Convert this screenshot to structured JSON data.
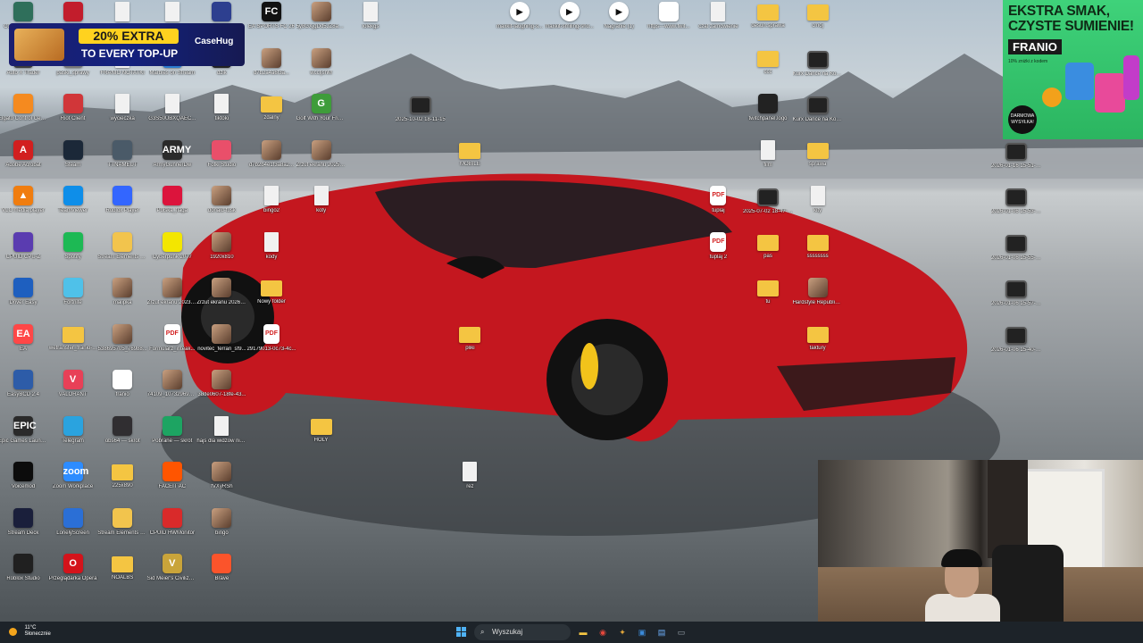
{
  "desktop": {
    "icons": [
      {
        "label": "Counter-Strike 2",
        "glyph": "",
        "kind": "app",
        "color": "#2f6f5b",
        "col": 0,
        "row": 0
      },
      {
        "label": "Auto X Trader",
        "glyph": "",
        "kind": "app",
        "color": "#3b3b3b",
        "col": 0,
        "row": 1
      },
      {
        "label": "Elgato Control Center",
        "glyph": "",
        "kind": "app",
        "color": "#f58a1f",
        "col": 0,
        "row": 2
      },
      {
        "label": "Adobe Acrobat",
        "glyph": "A",
        "kind": "app",
        "color": "#d21f1f",
        "col": 0,
        "row": 3
      },
      {
        "label": "VLC media player",
        "glyph": "▲",
        "kind": "app",
        "color": "#f07d0f",
        "col": 0,
        "row": 4
      },
      {
        "label": "CPUID CPU-Z",
        "glyph": "",
        "kind": "app",
        "color": "#5a3cb0",
        "col": 0,
        "row": 5
      },
      {
        "label": "Driver Easy",
        "glyph": "",
        "kind": "app",
        "color": "#1e5fbf",
        "col": 0,
        "row": 6
      },
      {
        "label": "EA",
        "glyph": "EA",
        "kind": "app",
        "color": "#ff4747",
        "col": 0,
        "row": 7
      },
      {
        "label": "EasyBCD 2.4",
        "glyph": "",
        "kind": "app",
        "color": "#2d5ca8",
        "col": 0,
        "row": 8
      },
      {
        "label": "Epic Games Launcher",
        "glyph": "EPIC",
        "kind": "app",
        "color": "#2a2a2a",
        "col": 0,
        "row": 9
      },
      {
        "label": "Voicemod",
        "glyph": "",
        "kind": "app",
        "color": "#0c0c0c",
        "col": 0,
        "row": 10
      },
      {
        "label": "Stream Deck",
        "glyph": "",
        "kind": "app",
        "color": "#1a1f3b",
        "col": 0,
        "row": 11
      },
      {
        "label": "Roblox Studio",
        "glyph": "",
        "kind": "app",
        "color": "#202020",
        "col": 0,
        "row": 12
      },
      {
        "label": "",
        "glyph": "",
        "kind": "app",
        "color": "#c21d2c",
        "col": 1,
        "row": 0
      },
      {
        "label": "paski_sprawy",
        "glyph": "",
        "kind": "app",
        "color": "#777",
        "col": 1,
        "row": 1
      },
      {
        "label": "Riot Client",
        "glyph": "",
        "kind": "app",
        "color": "#d13639",
        "col": 1,
        "row": 2
      },
      {
        "label": "Steam",
        "glyph": "",
        "kind": "app",
        "color": "#1b2838",
        "col": 1,
        "row": 3
      },
      {
        "label": "TeamViewer",
        "glyph": "",
        "kind": "app",
        "color": "#0e8ee9",
        "col": 1,
        "row": 4
      },
      {
        "label": "Spotify",
        "glyph": "",
        "kind": "app",
        "color": "#1db954",
        "col": 1,
        "row": 5
      },
      {
        "label": "Fortnite",
        "glyph": "",
        "kind": "app",
        "color": "#4fc1e9",
        "col": 1,
        "row": 6
      },
      {
        "label": "wetransfer_franio-...",
        "glyph": "",
        "kind": "folder",
        "color": "#f4c542",
        "col": 1,
        "row": 7
      },
      {
        "label": "VALORANT",
        "glyph": "V",
        "kind": "app",
        "color": "#e84057",
        "col": 1,
        "row": 8
      },
      {
        "label": "Telegram",
        "glyph": "",
        "kind": "app",
        "color": "#2aa3df",
        "col": 1,
        "row": 9
      },
      {
        "label": "Zoom Workplace",
        "glyph": "zoom",
        "kind": "app",
        "color": "#2d8cff",
        "col": 1,
        "row": 10
      },
      {
        "label": "LonelyScreen",
        "glyph": "",
        "kind": "app",
        "color": "#2b6fd6",
        "col": 1,
        "row": 11
      },
      {
        "label": "Przeglądarka Opera",
        "glyph": "O",
        "kind": "app",
        "color": "#d4131b",
        "col": 1,
        "row": 12
      },
      {
        "label": "",
        "glyph": "",
        "kind": "file",
        "color": "#f1f1f1",
        "col": 2,
        "row": 0
      },
      {
        "label": "FRANIO NOTATKI",
        "glyph": "",
        "kind": "file",
        "color": "#f1f1f1",
        "col": 2,
        "row": 1
      },
      {
        "label": "wycieczka",
        "glyph": "",
        "kind": "file",
        "color": "#f1f1f1",
        "col": 2,
        "row": 2
      },
      {
        "label": "TTNAMEUT",
        "glyph": "",
        "kind": "app",
        "color": "#4a5a68",
        "col": 2,
        "row": 3
      },
      {
        "label": "Roblox Player",
        "glyph": "",
        "kind": "app",
        "color": "#3366ff",
        "col": 2,
        "row": 4
      },
      {
        "label": "Stream Elements SE.Live",
        "glyph": "",
        "kind": "app",
        "color": "#f2c44d",
        "col": 2,
        "row": 5
      },
      {
        "label": "malipka",
        "glyph": "",
        "kind": "photo",
        "color": "#8a6b52",
        "col": 2,
        "row": 6
      },
      {
        "label": "538695705_76988...",
        "glyph": "",
        "kind": "photo",
        "color": "#8a6b52",
        "col": 2,
        "row": 7
      },
      {
        "label": "franio",
        "glyph": "",
        "kind": "app",
        "color": "#ffffff",
        "col": 2,
        "row": 8
      },
      {
        "label": "obs64 — skrót",
        "glyph": "",
        "kind": "app",
        "color": "#302e31",
        "col": 2,
        "row": 9
      },
      {
        "label": "225x890",
        "glyph": "",
        "kind": "folder",
        "color": "#f4c542",
        "col": 2,
        "row": 10
      },
      {
        "label": "Stream Elements SE.Live",
        "glyph": "",
        "kind": "app",
        "color": "#f2c44d",
        "col": 2,
        "row": 11
      },
      {
        "label": "NOALBS",
        "glyph": "",
        "kind": "folder",
        "color": "#f4c542",
        "col": 2,
        "row": 12
      },
      {
        "label": "",
        "glyph": "",
        "kind": "file",
        "color": "#f1f1f1",
        "col": 3,
        "row": 0
      },
      {
        "label": "Marbles on Stream",
        "glyph": "",
        "kind": "app",
        "color": "#2a7bd0",
        "col": 3,
        "row": 1
      },
      {
        "label": "G3S50UBXQAEC...",
        "glyph": "",
        "kind": "file",
        "color": "#f1f1f1",
        "col": 3,
        "row": 2
      },
      {
        "label": "ArmyGunnerDw",
        "glyph": "ARMY",
        "kind": "app",
        "color": "#2a2a2a",
        "col": 3,
        "row": 3
      },
      {
        "label": "Polska_flaga",
        "glyph": "",
        "kind": "app",
        "color": "#dc143c",
        "col": 3,
        "row": 4
      },
      {
        "label": "Cyberpunk 2077",
        "glyph": "",
        "kind": "app",
        "color": "#f3e600",
        "col": 3,
        "row": 5
      },
      {
        "label": "Zrzut ekranu 2023-12-18 205224",
        "glyph": "",
        "kind": "photo",
        "color": "#8a6b52",
        "col": 3,
        "row": 6
      },
      {
        "label": "Formularz_inteak...",
        "glyph": "PDF",
        "kind": "pdf",
        "color": "#ffffff",
        "col": 3,
        "row": 7
      },
      {
        "label": "74109_1073296993...",
        "glyph": "",
        "kind": "photo",
        "color": "#8a6b52",
        "col": 3,
        "row": 8
      },
      {
        "label": "Pobrane — skrót",
        "glyph": "",
        "kind": "app",
        "color": "#1da462",
        "col": 3,
        "row": 9
      },
      {
        "label": "FACEIT AC",
        "glyph": "",
        "kind": "app",
        "color": "#ff5500",
        "col": 3,
        "row": 10
      },
      {
        "label": "CPUID HWMonitor",
        "glyph": "",
        "kind": "app",
        "color": "#d92a2a",
        "col": 3,
        "row": 11
      },
      {
        "label": "Sid Meier's Civilization V",
        "glyph": "V",
        "kind": "app",
        "color": "#c9a43a",
        "col": 3,
        "row": 12
      },
      {
        "label": "",
        "glyph": "",
        "kind": "app",
        "color": "#2d3f8f",
        "col": 4,
        "row": 0
      },
      {
        "label": "dzik",
        "glyph": "",
        "kind": "app",
        "color": "#222",
        "col": 4,
        "row": 1
      },
      {
        "label": "tiktoki",
        "glyph": "",
        "kind": "file",
        "color": "#f1f1f1",
        "col": 4,
        "row": 2
      },
      {
        "label": "Fotki Studio",
        "glyph": "",
        "kind": "app",
        "color": "#e94f6a",
        "col": 4,
        "row": 3
      },
      {
        "label": "donald-tusk",
        "glyph": "",
        "kind": "photo",
        "color": "#8a6b52",
        "col": 4,
        "row": 4
      },
      {
        "label": "1920x810",
        "glyph": "",
        "kind": "photo",
        "color": "#8a6b52",
        "col": 4,
        "row": 5
      },
      {
        "label": "Zrzut ekranu 2026-01-17 132350",
        "glyph": "",
        "kind": "photo",
        "color": "#8a6b52",
        "col": 4,
        "row": 6
      },
      {
        "label": "novitec_ferrari_sf9...",
        "glyph": "",
        "kind": "photo",
        "color": "#b62027",
        "col": 4,
        "row": 7
      },
      {
        "label": "38de0607-18fe-43...",
        "glyph": "",
        "kind": "photo",
        "color": "#8a6b52",
        "col": 4,
        "row": 8
      },
      {
        "label": "hajs dla widzow nie otwierac",
        "glyph": "",
        "kind": "file",
        "color": "#f1f1f1",
        "col": 4,
        "row": 9
      },
      {
        "label": "fVXyRSh",
        "glyph": "",
        "kind": "photo",
        "color": "#4b8a55",
        "col": 4,
        "row": 10
      },
      {
        "label": "bingo",
        "glyph": "",
        "kind": "photo",
        "color": "#c7774d",
        "col": 4,
        "row": 11
      },
      {
        "label": "Brave",
        "glyph": "",
        "kind": "app",
        "color": "#fb542b",
        "col": 4,
        "row": 12
      },
      {
        "label": "EA SPORTS FC 26",
        "glyph": "FC",
        "kind": "app",
        "color": "#111",
        "col": 5,
        "row": 0
      },
      {
        "label": "d7b2a4a6f3a...",
        "glyph": "",
        "kind": "photo",
        "color": "#8a6b52",
        "col": 5,
        "row": 1
      },
      {
        "label": "zdalny",
        "glyph": "",
        "kind": "folder",
        "color": "#f4c542",
        "col": 5,
        "row": 2
      },
      {
        "label": "d7b2b4e1f3a8a2...",
        "glyph": "",
        "kind": "photo",
        "color": "#8a6b52",
        "col": 5,
        "row": 3
      },
      {
        "label": "bingo2",
        "glyph": "",
        "kind": "file",
        "color": "#f1f1f1",
        "col": 5,
        "row": 4
      },
      {
        "label": "kody",
        "glyph": "",
        "kind": "file",
        "color": "#f1f1f1",
        "col": 5,
        "row": 5
      },
      {
        "label": "Nowy folder",
        "glyph": "",
        "kind": "folder",
        "color": "#f4c542",
        "col": 5,
        "row": 6
      },
      {
        "label": "29179013-0c73-4c...",
        "glyph": "PDF",
        "kind": "pdf",
        "color": "#ffffff",
        "col": 5,
        "row": 7
      },
      {
        "label": "5y8GXjgDd5JZ8aS...",
        "glyph": "",
        "kind": "photo",
        "color": "#8a6b52",
        "col": 6,
        "row": 0
      },
      {
        "label": "wccfjsnM",
        "glyph": "",
        "kind": "photo",
        "color": "#8a6b52",
        "col": 6,
        "row": 1
      },
      {
        "label": "Golf With Your Friends",
        "glyph": "G",
        "kind": "app",
        "color": "#3e9c3a",
        "col": 6,
        "row": 2
      },
      {
        "label": "Zrzut ekranu 2025-01-19 021722",
        "glyph": "",
        "kind": "photo",
        "color": "#8a6b52",
        "col": 6,
        "row": 3
      },
      {
        "label": "koty",
        "glyph": "",
        "kind": "file",
        "color": "#f1f1f1",
        "col": 6,
        "row": 4
      },
      {
        "label": "HOLY",
        "glyph": "",
        "kind": "folder",
        "color": "#f4c542",
        "col": 6,
        "row": 9
      },
      {
        "label": "lolekgs",
        "glyph": "",
        "kind": "file",
        "color": "#f1f1f1",
        "col": 7,
        "row": 0
      },
      {
        "label": "2025-10-02 18-11-15",
        "glyph": "",
        "kind": "video",
        "color": "#222",
        "col": 8,
        "row": 2
      },
      {
        "label": "MOBILE",
        "glyph": "",
        "kind": "folder",
        "color": "#f4c542",
        "col": 9,
        "row": 3
      },
      {
        "label": "pliki",
        "glyph": "",
        "kind": "folder",
        "color": "#f4c542",
        "col": 9,
        "row": 7
      },
      {
        "label": "rez",
        "glyph": "",
        "kind": "file",
        "color": "#f1f1f1",
        "col": 9,
        "row": 10
      },
      {
        "label": "maxkit-laughing-s...",
        "glyph": "▶",
        "kind": "media",
        "color": "#ffffff",
        "col": 10,
        "row": 0
      },
      {
        "label": "maxkit-smiling-sho...",
        "glyph": "▶",
        "kind": "media",
        "color": "#ffffff",
        "col": 11,
        "row": 0
      },
      {
        "label": "Nagranie (1)",
        "glyph": "▶",
        "kind": "media",
        "color": "#ffffff",
        "col": 12,
        "row": 0
      },
      {
        "label": "https---www.twit...",
        "glyph": "",
        "kind": "app",
        "color": "#ffffff",
        "col": 13,
        "row": 0
      },
      {
        "label": "czat zamowienie",
        "glyph": "",
        "kind": "file",
        "color": "#f1f1f1",
        "col": 14,
        "row": 0
      },
      {
        "label": "tuplaj",
        "glyph": "PDF",
        "kind": "pdf",
        "color": "#ffffff",
        "col": 14,
        "row": 4
      },
      {
        "label": "tuplaj 2",
        "glyph": "PDF",
        "kind": "pdf",
        "color": "#ffffff",
        "col": 14,
        "row": 5
      },
      {
        "label": "desun.sprawa",
        "glyph": "",
        "kind": "folder",
        "color": "#f4c542",
        "col": 15,
        "row": 0
      },
      {
        "label": "ccc",
        "glyph": "",
        "kind": "folder",
        "color": "#f4c542",
        "col": 15,
        "row": 1
      },
      {
        "label": "twitchpanel.logo",
        "glyph": "",
        "kind": "app",
        "color": "#222",
        "col": 15,
        "row": 2
      },
      {
        "label": "film",
        "glyph": "",
        "kind": "file",
        "color": "#f1f1f1",
        "col": 15,
        "row": 3
      },
      {
        "label": "2025-07-02 18-47-41",
        "glyph": "",
        "kind": "video",
        "color": "#222",
        "col": 15,
        "row": 4
      },
      {
        "label": "pas",
        "glyph": "",
        "kind": "folder",
        "color": "#f4c542",
        "col": 15,
        "row": 5
      },
      {
        "label": "tu",
        "glyph": "",
        "kind": "folder",
        "color": "#f4c542",
        "col": 15,
        "row": 6
      },
      {
        "label": "cmoj",
        "glyph": "",
        "kind": "folder",
        "color": "#f4c542",
        "col": 16,
        "row": 0
      },
      {
        "label": "Kurx Dance na Koncie",
        "glyph": "",
        "kind": "video",
        "color": "#222",
        "col": 16,
        "row": 1
      },
      {
        "label": "Kurx Dance na Koncie (mark...)",
        "glyph": "",
        "kind": "video",
        "color": "#222",
        "col": 16,
        "row": 2
      },
      {
        "label": "sprawa",
        "glyph": "",
        "kind": "folder",
        "color": "#f4c542",
        "col": 16,
        "row": 3
      },
      {
        "label": "kity",
        "glyph": "",
        "kind": "file",
        "color": "#f1f1f1",
        "col": 16,
        "row": 4
      },
      {
        "label": "ssssssss",
        "glyph": "",
        "kind": "folder",
        "color": "#f4c542",
        "col": 16,
        "row": 5
      },
      {
        "label": "Hardstyle Republic Nervarien - One day",
        "glyph": "",
        "kind": "photo",
        "color": "#8a6b52",
        "col": 16,
        "row": 6
      },
      {
        "label": "faktury",
        "glyph": "",
        "kind": "folder",
        "color": "#f4c542",
        "col": 16,
        "row": 7
      },
      {
        "label": "2026-01-16 15-51-29",
        "glyph": "",
        "kind": "video",
        "color": "#222",
        "col": 20,
        "row": 3
      },
      {
        "label": "2026-01-06 15-53-43",
        "glyph": "",
        "kind": "video",
        "color": "#222",
        "col": 20,
        "row": 4
      },
      {
        "label": "2026-01-06 15-55-25",
        "glyph": "",
        "kind": "video",
        "color": "#222",
        "col": 20,
        "row": 5
      },
      {
        "label": "2026-01-06 15-57-29",
        "glyph": "",
        "kind": "video",
        "color": "#222",
        "col": 20,
        "row": 6
      },
      {
        "label": "2026-01-06 15-40-13",
        "glyph": "",
        "kind": "video",
        "color": "#222",
        "col": 20,
        "row": 7
      }
    ]
  },
  "ads": {
    "casehug": {
      "extra": "20% EXTRA",
      "tagline": "TO EVERY TOP-UP",
      "brand": "CaseHug"
    },
    "franio": {
      "headline": "EKSTRA SMAK, CZYSTE SUMIENIE!",
      "brand": "FRANIO",
      "sub": "10% zniżki z kodem",
      "badge": "DARMOWA WYSYŁKA!"
    }
  },
  "taskbar": {
    "weather_temp": "11°C",
    "weather_desc": "Słonecznie",
    "search_placeholder": "Wyszukaj",
    "pinned": [
      {
        "name": "file-explorer-taskbar-button",
        "glyph": "▬",
        "color": "#f4c542"
      },
      {
        "name": "chrome-taskbar-button",
        "glyph": "◉",
        "color": "#e5483c"
      },
      {
        "name": "app-taskbar-button",
        "glyph": "✦",
        "color": "#e2a63a"
      },
      {
        "name": "terminal-taskbar-button",
        "glyph": "▣",
        "color": "#3b8ad9"
      },
      {
        "name": "notes-taskbar-button",
        "glyph": "▤",
        "color": "#6fb2ff"
      },
      {
        "name": "monitor-taskbar-button",
        "glyph": "▭",
        "color": "#9aa4ad"
      }
    ]
  },
  "colors": {
    "car_red": "#c4171f",
    "taskbar": "#1d2329",
    "folder": "#f4c542"
  }
}
